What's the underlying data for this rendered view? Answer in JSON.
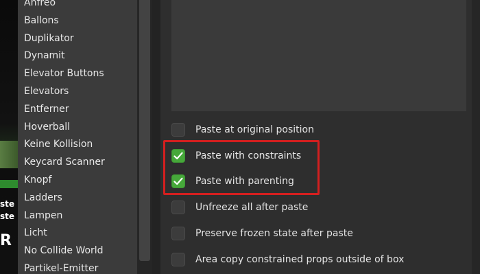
{
  "game_background": {
    "overlay_texts": [
      "ste",
      "ste",
      "R"
    ]
  },
  "tool_list": {
    "items": [
      "Anfreo",
      "Ballons",
      "Duplikator",
      "Dynamit",
      "Elevator Buttons",
      "Elevators",
      "Entferner",
      "Hoverball",
      "Keine Kollision",
      "Keycard Scanner",
      "Knopf",
      "Ladders",
      "Lampen",
      "Licht",
      "No Collide World",
      "Partikel-Emitter"
    ]
  },
  "options": [
    {
      "label": "Paste at original position",
      "checked": false
    },
    {
      "label": "Paste with constraints",
      "checked": true
    },
    {
      "label": "Paste with parenting",
      "checked": true
    },
    {
      "label": "Unfreeze all after paste",
      "checked": false
    },
    {
      "label": "Preserve frozen state after paste",
      "checked": false
    },
    {
      "label": "Area copy constrained props outside of box",
      "checked": false
    }
  ],
  "colors": {
    "checkbox_checked": "#46a83a",
    "highlight_border": "#d41f1f",
    "panel_bg": "#2e2e2e",
    "list_bg": "#3b3b3b"
  }
}
